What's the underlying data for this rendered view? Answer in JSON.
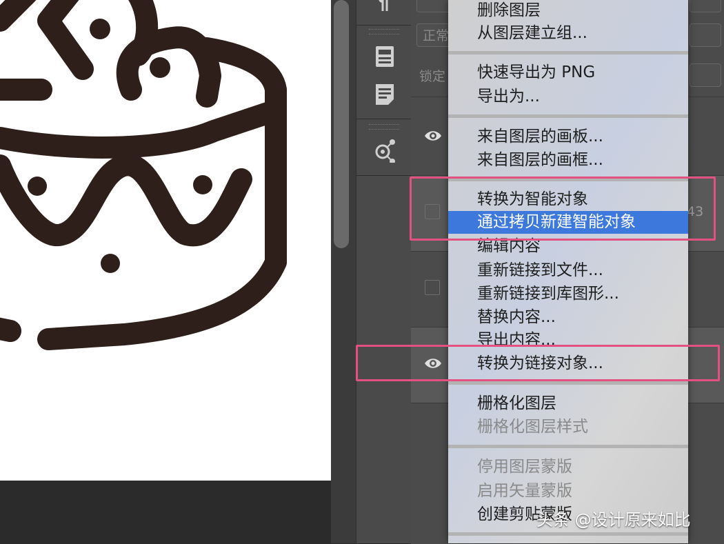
{
  "panel": {
    "blend_mode_partial": "正常",
    "lock_label_partial": "锁定",
    "layer_number_partial": "43"
  },
  "context_menu": {
    "items": [
      {
        "label": "删除图层",
        "enabled": true
      },
      {
        "label": "从图层建立组...",
        "enabled": true
      },
      {
        "label": "快速导出为 PNG",
        "enabled": true
      },
      {
        "label": "导出为...",
        "enabled": true
      },
      {
        "label": "来自图层的画板...",
        "enabled": true
      },
      {
        "label": "来自图层的画框...",
        "enabled": true
      },
      {
        "label": "转换为智能对象",
        "enabled": true
      },
      {
        "label": "通过拷贝新建智能对象",
        "enabled": true,
        "highlighted": true
      },
      {
        "label": "编辑内容",
        "enabled": true
      },
      {
        "label": "重新链接到文件...",
        "enabled": true
      },
      {
        "label": "重新链接到库图形...",
        "enabled": true
      },
      {
        "label": "替换内容...",
        "enabled": true
      },
      {
        "label": "导出内容...",
        "enabled": true
      },
      {
        "label": "转换为链接对象...",
        "enabled": true
      },
      {
        "label": "栅格化图层",
        "enabled": true
      },
      {
        "label": "栅格化图层样式",
        "enabled": false
      },
      {
        "label": "停用图层蒙版",
        "enabled": false
      },
      {
        "label": "启用矢量蒙版",
        "enabled": false
      },
      {
        "label": "创建剪贴蒙版",
        "enabled": true
      }
    ]
  },
  "watermark": "头条 @设计原来如比",
  "colors": {
    "highlight": "#3d78dc",
    "annotation_box": "#e2517f",
    "artwork_stroke": "#2e1f1a"
  }
}
